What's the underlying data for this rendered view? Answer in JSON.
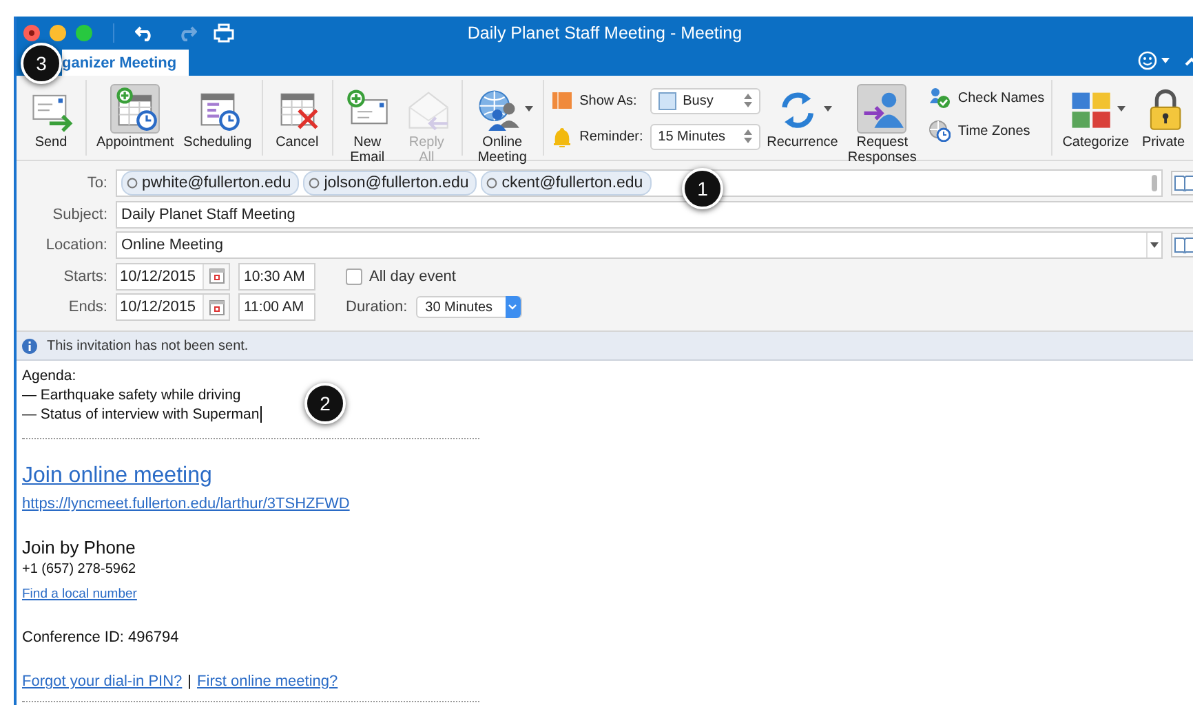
{
  "window": {
    "title": "Daily Planet Staff Meeting - Meeting"
  },
  "tabs": [
    {
      "label": "ganizer Meeting",
      "selected": true
    }
  ],
  "ribbon": [
    {
      "items": [
        {
          "kind": "large",
          "label": "Send",
          "selected": false,
          "disabled": false
        }
      ]
    },
    {
      "items": [
        {
          "kind": "large",
          "label": "Appointment",
          "selected": true,
          "disabled": false
        },
        {
          "kind": "large",
          "label": "Scheduling",
          "selected": false,
          "disabled": false
        }
      ]
    },
    {
      "items": [
        {
          "kind": "large",
          "label": "Cancel",
          "selected": false,
          "disabled": false
        }
      ]
    },
    {
      "items": [
        {
          "kind": "large",
          "label": "New Email",
          "selected": false,
          "disabled": false
        },
        {
          "kind": "large",
          "label": "Reply All",
          "selected": false,
          "disabled": true
        }
      ]
    },
    {
      "items": [
        {
          "kind": "large",
          "label": "Online Meeting",
          "selected": false,
          "disabled": false,
          "menu": true
        }
      ]
    },
    {
      "items": [
        {
          "kind": "stack",
          "rows": [
            {
              "label": "Show As:",
              "value": "Busy"
            },
            {
              "label": "Reminder:",
              "value": "15 Minutes"
            }
          ]
        },
        {
          "kind": "large",
          "label": "Recurrence",
          "selected": false,
          "disabled": false,
          "menu": true
        },
        {
          "kind": "large",
          "label": "Request Responses",
          "selected": true,
          "disabled": false
        },
        {
          "kind": "links",
          "rows": [
            {
              "label": "Check Names"
            },
            {
              "label": "Time Zones"
            }
          ]
        }
      ]
    },
    {
      "items": [
        {
          "kind": "large",
          "label": "Categorize",
          "selected": false,
          "disabled": false,
          "menu": true
        },
        {
          "kind": "large",
          "label": "Private",
          "selected": false,
          "disabled": false
        }
      ]
    }
  ],
  "form": {
    "to": {
      "label": "To:",
      "recipients": [
        "pwhite@fullerton.edu",
        "jolson@fullerton.edu",
        "ckent@fullerton.edu"
      ]
    },
    "subject": {
      "label": "Subject:",
      "value": "Daily Planet Staff Meeting"
    },
    "location": {
      "label": "Location:",
      "value": "Online Meeting"
    },
    "starts": {
      "label": "Starts:",
      "date": "10/12/2015",
      "time": "10:30 AM"
    },
    "all_day": {
      "label": "All day event",
      "checked": false
    },
    "ends": {
      "label": "Ends:",
      "date": "10/12/2015",
      "time": "11:00 AM"
    },
    "duration": {
      "label": "Duration:",
      "value": "30 Minutes"
    }
  },
  "info": {
    "message": "This invitation has not been sent."
  },
  "body": {
    "agenda": [
      "Agenda:",
      "— Earthquake safety while driving",
      "— Status of interview with Superman"
    ],
    "join_link": "Join online meeting",
    "url": "https://lyncmeet.fullerton.edu/larthur/3TSHZFWD",
    "phone_heading": "Join by Phone",
    "phone": "+1 (657) 278-5962",
    "local_link": "Find a local number",
    "conference_id": "Conference ID: 496794",
    "footer_links": [
      "Forgot your dial-in PIN?",
      "First online meeting?"
    ],
    "separator": "|"
  },
  "callouts": [
    "1",
    "2",
    "3"
  ]
}
